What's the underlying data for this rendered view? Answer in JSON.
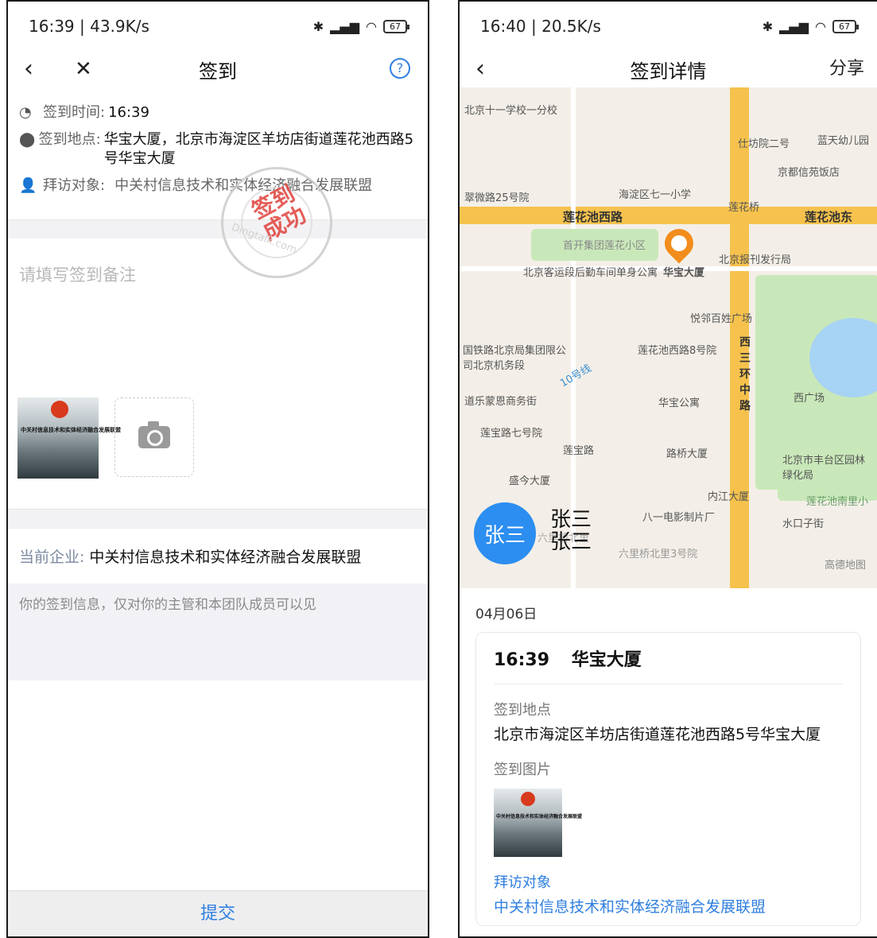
{
  "left": {
    "status": {
      "time": "16:39 | 43.9K/s",
      "battery": "67"
    },
    "nav": {
      "title": "签到",
      "back": "‹",
      "close": "✕",
      "help": "?"
    },
    "info": {
      "time_label": "签到时间:",
      "time_value": "16:39",
      "place_label": "签到地点:",
      "place_value": "华宝大厦，北京市海淀区羊坊店街道莲花池西路5号华宝大厦",
      "visit_label": "拜访对象:",
      "visit_value": "中关村信息技术和实体经济融合发展联盟"
    },
    "stamp": {
      "text": "签到成功",
      "ring": "Dingtalk.com"
    },
    "remark_placeholder": "请填写签到备注",
    "thumb_text": "中关村信息技术和实体经济融合发展联盟",
    "company": {
      "label": "当前企业:",
      "value": "中关村信息技术和实体经济融合发展联盟"
    },
    "notice": "你的签到信息，仅对你的主管和本团队成员可以见",
    "submit": "提交"
  },
  "right": {
    "status": {
      "time": "16:40 | 20.5K/s",
      "battery": "67"
    },
    "nav": {
      "title": "签到详情",
      "back": "‹",
      "share": "分享"
    },
    "map": {
      "labels": [
        "北京十一学校一分校",
        "仕坊院二号",
        "蓝天幼儿园",
        "京都信苑饭店",
        "翠微路25号院",
        "海淀区七一小学",
        "莲花桥",
        "首开集团莲花小区",
        "北京客运段后勤车间单身公寓",
        "华宝大厦",
        "北京报刊发行局",
        "悦邻百姓广场",
        "国铁路北京局集团限公司北京机务段",
        "莲花池西路8号院",
        "道乐蒙恩商务街",
        "华宝公寓",
        "西广场",
        "莲宝路七号院",
        "莲宝路",
        "路桥大厦",
        "北京市丰台区园林绿化局",
        "盛今大厦",
        "内江大厦",
        "八一电影制片厂",
        "莲花池南里小",
        "水口子街",
        "六里桥北里",
        "六里桥北里3号院",
        "高德地图"
      ],
      "roads": [
        "莲花池西路",
        "莲花池东",
        "西三环中路",
        "10号线"
      ],
      "avatar": "张三",
      "name_lines": [
        "张三",
        "张三"
      ]
    },
    "detail": {
      "date": "04月06日",
      "time": "16:39",
      "place_name": "华宝大厦",
      "place_label": "签到地点",
      "place_value": "北京市海淀区羊坊店街道莲花池西路5号华宝大厦",
      "photo_label": "签到图片",
      "visit_label": "拜访对象",
      "visit_value": "中关村信息技术和实体经济融合发展联盟"
    }
  },
  "colors": {
    "accent": "#2f7fe0",
    "stamp_red": "#e0413c",
    "pin": "#f28c1c",
    "road": "#f6c24d"
  }
}
